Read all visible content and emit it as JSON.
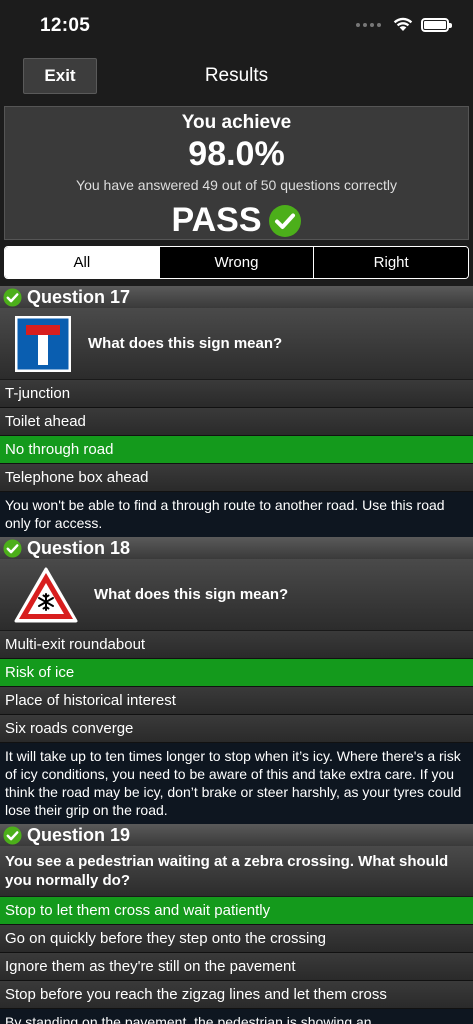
{
  "status": {
    "time": "12:05"
  },
  "nav": {
    "exit_label": "Exit",
    "title": "Results"
  },
  "summary": {
    "heading": "You achieve",
    "percent": "98.0%",
    "detail": "You have answered 49 out of 50 questions correctly",
    "result": "PASS"
  },
  "tabs": [
    {
      "label": "All",
      "active": true
    },
    {
      "label": "Wrong",
      "active": false
    },
    {
      "label": "Right",
      "active": false
    }
  ],
  "questions": [
    {
      "title": "Question 17",
      "sign": "no-through-road-sign",
      "text": "What does this sign mean?",
      "answers": [
        "T-junction",
        "Toilet ahead",
        "No through road",
        "Telephone box ahead"
      ],
      "correct_index": 2,
      "explanation": "You won't be able to find a through route to another road. Use this road only for access."
    },
    {
      "title": "Question 18",
      "sign": "risk-of-ice-sign",
      "text": "What does this sign mean?",
      "answers": [
        "Multi-exit roundabout",
        "Risk of ice",
        "Place of historical interest",
        "Six roads converge"
      ],
      "correct_index": 1,
      "explanation": "It will take up to ten times longer to stop when it’s icy. Where there's a risk of icy conditions, you need to be aware of this and take extra care. If you think the road may be icy, don’t brake or steer harshly, as your tyres could lose their grip on the road."
    },
    {
      "title": "Question 19",
      "sign": null,
      "text": "You see a pedestrian waiting at a zebra crossing. What should you normally do?",
      "answers": [
        "Stop to let them cross and wait patiently",
        "Go on quickly before they step onto the crossing",
        "Ignore them as they're still on the pavement",
        "Stop before you reach the zigzag lines and let them cross"
      ],
      "correct_index": 0,
      "explanation": "By standing on the pavement, the pedestrian is showing an"
    }
  ],
  "colors": {
    "correct": "#149a1c",
    "check": "#4caf1a",
    "sign_blue": "#0a5eb0",
    "sign_red": "#d81e1e"
  }
}
